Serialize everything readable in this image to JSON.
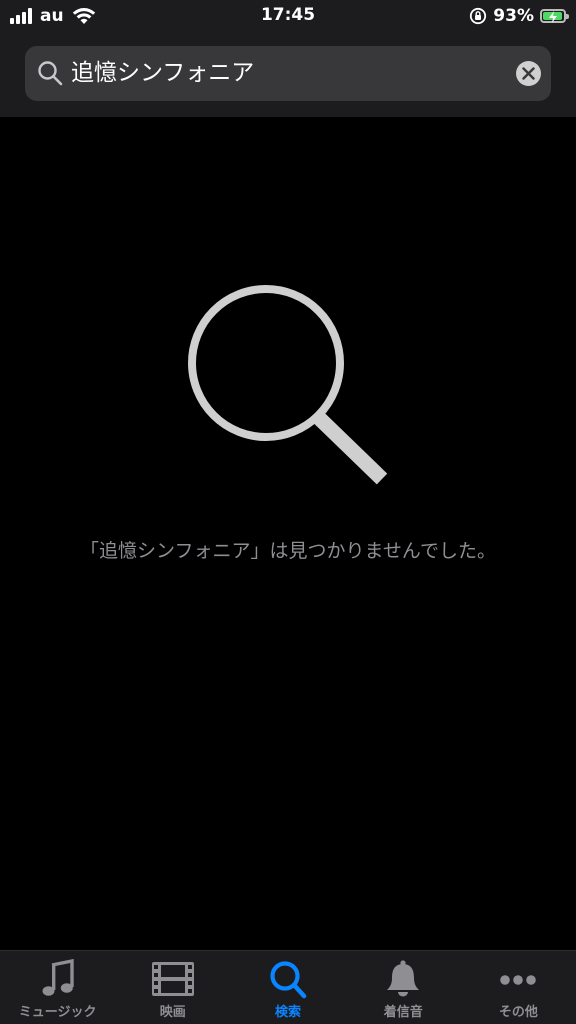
{
  "status_bar": {
    "carrier": "au",
    "time": "17:45",
    "battery_percent": "93%",
    "battery_level": 0.93,
    "icons": [
      "signal-icon",
      "wifi-icon",
      "orientation-lock-icon",
      "battery-charging-icon"
    ]
  },
  "search": {
    "query": "追憶シンフォニア",
    "icons": [
      "search-icon",
      "clear-icon"
    ]
  },
  "empty_state": {
    "message": "「追憶シンフォニア」は見つかりませんでした。",
    "icon": "magnifier-icon"
  },
  "tab_bar": {
    "tabs": [
      {
        "label": "ミュージック",
        "icon": "music-note-icon",
        "active": false
      },
      {
        "label": "映画",
        "icon": "film-icon",
        "active": false
      },
      {
        "label": "検索",
        "icon": "search-icon",
        "active": true
      },
      {
        "label": "着信音",
        "icon": "bell-icon",
        "active": false
      },
      {
        "label": "その他",
        "icon": "more-icon",
        "active": false
      }
    ]
  },
  "colors": {
    "background": "#000000",
    "bar_background": "#1c1c1e",
    "search_field": "#38383a",
    "accent": "#0a84ff",
    "inactive": "#8e8e93",
    "battery": "#4cd964"
  }
}
